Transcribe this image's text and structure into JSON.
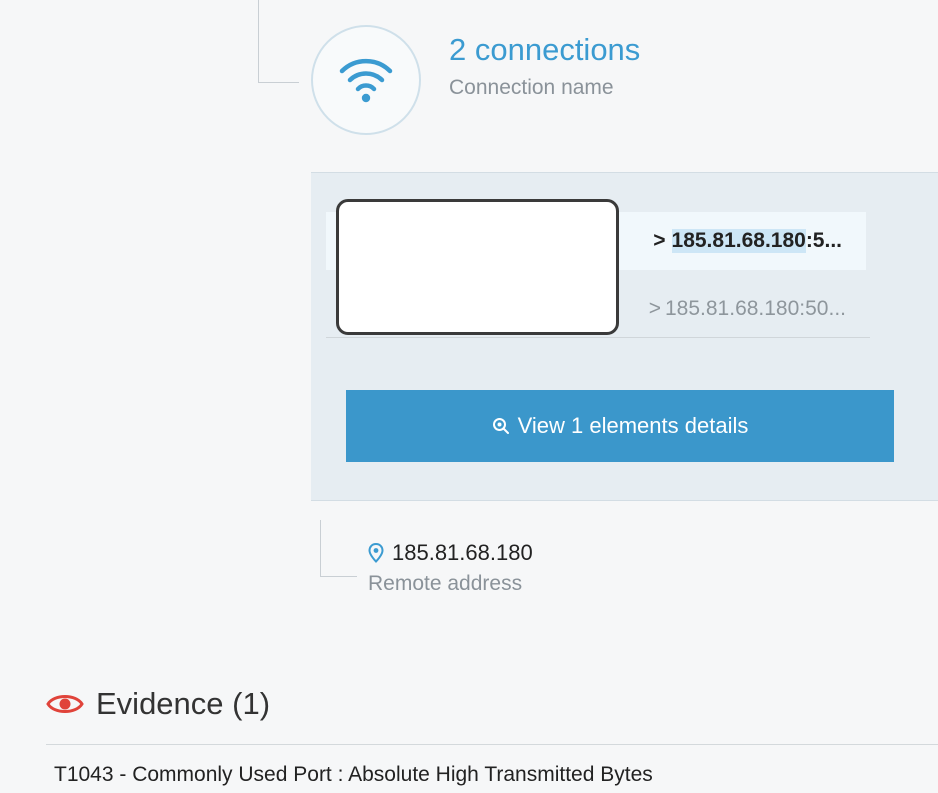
{
  "connections": {
    "title": "2 connections",
    "subtitle": "Connection name",
    "icon": "wifi-icon"
  },
  "connection_rows": [
    {
      "arrow": ">",
      "ip_highlight": "185.81.68.180",
      "ip_rest": ":5...",
      "selected": true
    },
    {
      "arrow": ">",
      "ip_full": "185.81.68.180:50...",
      "selected": false
    }
  ],
  "view_button": {
    "label": "View 1 elements details",
    "icon": "magnifier-icon"
  },
  "remote": {
    "address": "185.81.68.180",
    "label": "Remote address",
    "icon": "location-pin-icon"
  },
  "evidence": {
    "title": "Evidence (1)",
    "icon": "eye-icon",
    "items": [
      "T1043 - Commonly Used Port : Absolute High Transmitted Bytes"
    ]
  },
  "colors": {
    "accent": "#3b97cb",
    "title_blue": "#3b9bd1",
    "eye_red": "#e0433a",
    "panel_bg": "#e6edf2"
  }
}
